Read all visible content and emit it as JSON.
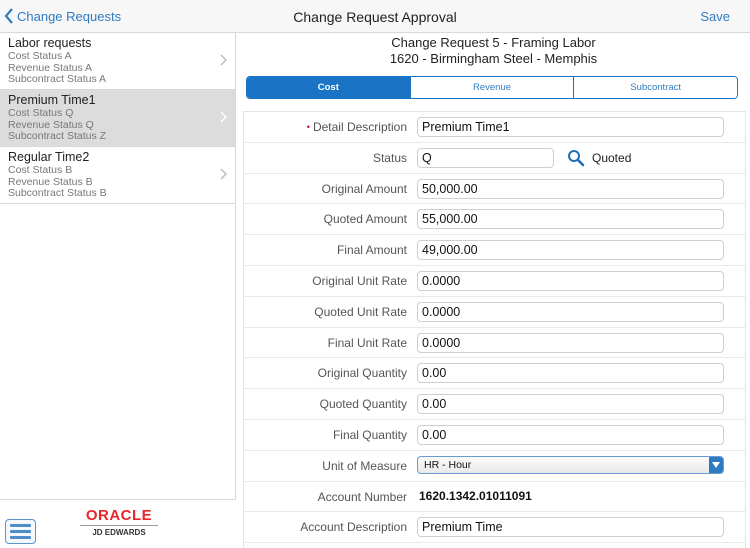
{
  "topbar": {
    "back_label": "Change Requests",
    "title": "Change Request Approval",
    "save_label": "Save"
  },
  "sidebar": {
    "items": [
      {
        "title": "Labor requests",
        "lines": [
          "Cost Status A",
          "Revenue Status A",
          "Subcontract Status A"
        ],
        "selected": false
      },
      {
        "title": "Premium Time1",
        "lines": [
          "Cost Status Q",
          "Revenue Status Q",
          "Subcontract Status Z"
        ],
        "selected": true
      },
      {
        "title": "Regular Time2",
        "lines": [
          "Cost Status B",
          "Revenue Status B",
          "Subcontract Status B"
        ],
        "selected": false
      }
    ],
    "logo": {
      "brand": "ORACLE",
      "product": "JD EDWARDS"
    }
  },
  "main": {
    "header_line1": "Change Request 5 - Framing Labor",
    "header_line2": "1620 - Birmingham Steel - Memphis",
    "tabs": [
      {
        "label": "Cost",
        "active": true
      },
      {
        "label": "Revenue",
        "active": false
      },
      {
        "label": "Subcontract",
        "active": false
      }
    ],
    "form": {
      "detail_description": {
        "label": "Detail Description",
        "value": "Premium Time1",
        "required": true
      },
      "status": {
        "label": "Status",
        "value": "Q",
        "description": "Quoted"
      },
      "original_amount": {
        "label": "Original Amount",
        "value": "50,000.00"
      },
      "quoted_amount": {
        "label": "Quoted Amount",
        "value": "55,000.00"
      },
      "final_amount": {
        "label": "Final Amount",
        "value": "49,000.00"
      },
      "original_unit_rate": {
        "label": "Original Unit Rate",
        "value": "0.0000"
      },
      "quoted_unit_rate": {
        "label": "Quoted Unit Rate",
        "value": "0.0000"
      },
      "final_unit_rate": {
        "label": "Final Unit Rate",
        "value": "0.0000"
      },
      "original_quantity": {
        "label": "Original Quantity",
        "value": "0.00"
      },
      "quoted_quantity": {
        "label": "Quoted Quantity",
        "value": "0.00"
      },
      "final_quantity": {
        "label": "Final Quantity",
        "value": "0.00"
      },
      "unit_of_measure": {
        "label": "Unit of Measure",
        "value": "HR - Hour"
      },
      "account_number": {
        "label": "Account Number",
        "value": "1620.1342.01011091"
      },
      "account_description": {
        "label": "Account Description",
        "value": "Premium Time"
      }
    }
  },
  "colors": {
    "accent": "#1a73c5",
    "link": "#2f7bc1",
    "selected_row": "#dcdcdc",
    "required": "#d0021b",
    "oracle_red": "#e8262a"
  }
}
